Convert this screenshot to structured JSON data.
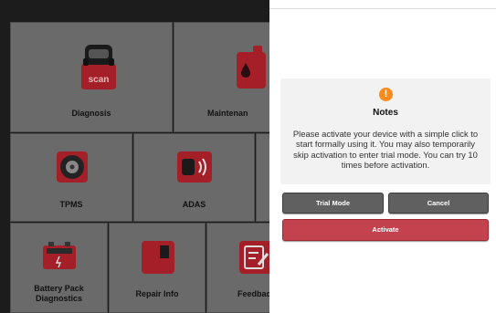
{
  "tiles": {
    "diagnosis": {
      "label": "Diagnosis",
      "icon_text": "scan"
    },
    "maintenance": {
      "label": "Maintenan"
    },
    "tpms": {
      "label": "TPMS"
    },
    "adas": {
      "label": "ADAS"
    },
    "battery": {
      "label": "Battery Pack\nDiagnostics"
    },
    "repair": {
      "label": "Repair Info"
    },
    "feedback": {
      "label": "Feedbac"
    }
  },
  "dialog": {
    "icon": "!",
    "title": "Notes",
    "message": "Please activate your device with a simple click to start formally using it. You may also temporarily skip activation to enter trial mode. You can try 10 times before activation.",
    "trial_label": "Trial Mode",
    "cancel_label": "Cancel",
    "activate_label": "Activate"
  },
  "colors": {
    "accent_red": "#c3424e",
    "notes_orange": "#ff8a1c",
    "overlay_tile": "#6a6a6a"
  }
}
